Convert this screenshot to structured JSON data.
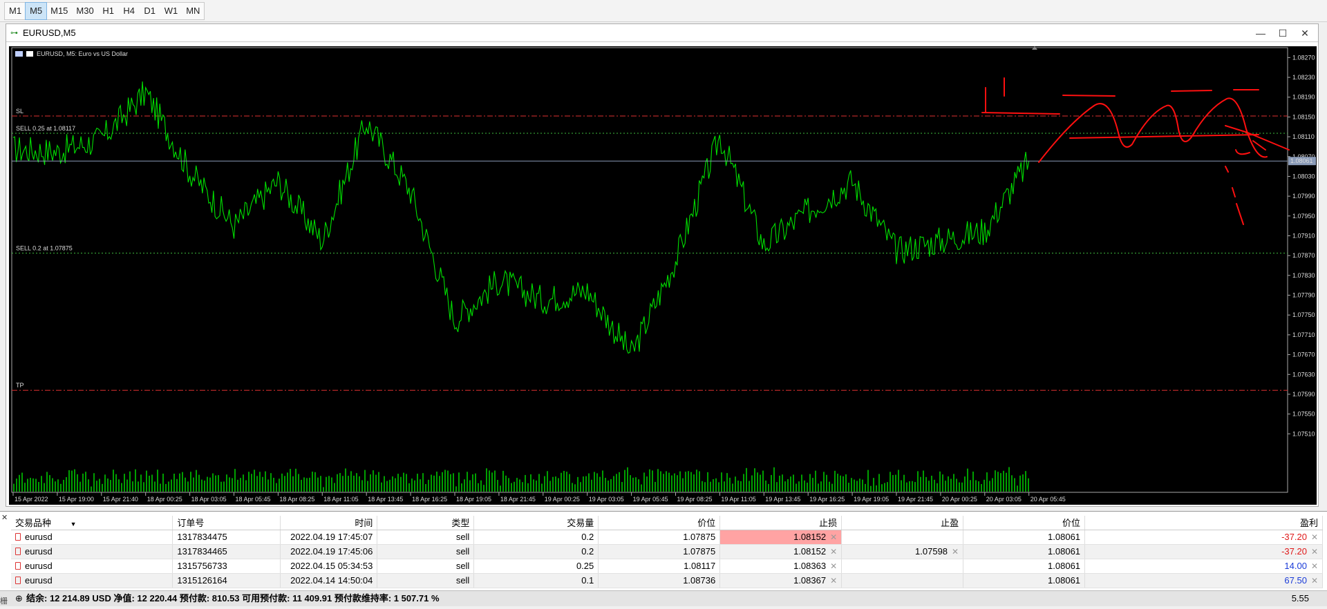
{
  "toolbar": {
    "timeframes": [
      {
        "label": "M1",
        "active": false
      },
      {
        "label": "M5",
        "active": true
      },
      {
        "label": "M15",
        "active": false
      },
      {
        "label": "M30",
        "active": false
      },
      {
        "label": "H1",
        "active": false
      },
      {
        "label": "H4",
        "active": false
      },
      {
        "label": "D1",
        "active": false
      },
      {
        "label": "W1",
        "active": false
      },
      {
        "label": "MN",
        "active": false
      }
    ]
  },
  "window": {
    "title": "EURUSD,M5",
    "controls": {
      "minimize": "—",
      "maximize": "☐",
      "close": "✕"
    }
  },
  "chart_data": {
    "type": "line",
    "symbol_caption": "EURUSD, M5:  Euro vs US Dollar",
    "line_color": "#00e000",
    "background": "#000000",
    "current_price": 1.08061,
    "ylim": [
      1.0747,
      1.0829
    ],
    "y_ticks": [
      "1.08270",
      "1.08230",
      "1.08190",
      "1.08150",
      "1.08110",
      "1.08070",
      "1.08030",
      "1.07990",
      "1.07950",
      "1.07910",
      "1.07870",
      "1.07830",
      "1.07790",
      "1.07750",
      "1.07710",
      "1.07670",
      "1.07630",
      "1.07590",
      "1.07550",
      "1.07510"
    ],
    "x_ticks": [
      "15 Apr 2022",
      "15 Apr 19:00",
      "15 Apr 21:40",
      "18 Apr 00:25",
      "18 Apr 03:05",
      "18 Apr 05:45",
      "18 Apr 08:25",
      "18 Apr 11:05",
      "18 Apr 13:45",
      "18 Apr 16:25",
      "18 Apr 19:05",
      "18 Apr 21:45",
      "19 Apr 00:25",
      "19 Apr 03:05",
      "19 Apr 05:45",
      "19 Apr 08:25",
      "19 Apr 11:05",
      "19 Apr 13:45",
      "19 Apr 16:25",
      "19 Apr 19:05",
      "19 Apr 21:45",
      "20 Apr 00:25",
      "20 Apr 03:05",
      "20 Apr 05:45"
    ],
    "levels": [
      {
        "label": "SL",
        "price": 1.08152,
        "style": "dashdot",
        "color": "#e03030"
      },
      {
        "label": "SELL 0.25 at 1.08117",
        "price": 1.08117,
        "style": "dotted",
        "color": "#40c040"
      },
      {
        "label": "SELL 0.2 at 1.07875",
        "price": 1.07875,
        "style": "dotted",
        "color": "#40c040"
      },
      {
        "label": "TP",
        "price": 1.07598,
        "style": "dashdot",
        "color": "#e03030"
      }
    ],
    "series": [
      {
        "x": "15 Apr 2022",
        "y": 1.08085
      },
      {
        "x": "15 Apr 19:00",
        "y": 1.0808
      },
      {
        "x": "15 Apr 21:40",
        "y": 1.08105
      },
      {
        "x": "18 Apr 00:25",
        "y": 1.082
      },
      {
        "x": "18 Apr 03:05",
        "y": 1.0804
      },
      {
        "x": "18 Apr 05:45",
        "y": 1.0793
      },
      {
        "x": "18 Apr 08:25",
        "y": 1.0802
      },
      {
        "x": "18 Apr 11:05",
        "y": 1.079
      },
      {
        "x": "18 Apr 13:45",
        "y": 1.0814
      },
      {
        "x": "18 Apr 16:25",
        "y": 1.08
      },
      {
        "x": "18 Apr 19:05",
        "y": 1.0774
      },
      {
        "x": "18 Apr 21:45",
        "y": 1.0782
      },
      {
        "x": "19 Apr 00:25",
        "y": 1.0778
      },
      {
        "x": "19 Apr 03:05",
        "y": 1.078
      },
      {
        "x": "19 Apr 05:45",
        "y": 1.0767
      },
      {
        "x": "19 Apr 08:25",
        "y": 1.0786
      },
      {
        "x": "19 Apr 11:05",
        "y": 1.0811
      },
      {
        "x": "19 Apr 13:45",
        "y": 1.0789
      },
      {
        "x": "19 Apr 16:25",
        "y": 1.0796
      },
      {
        "x": "19 Apr 19:05",
        "y": 1.0802
      },
      {
        "x": "19 Apr 21:45",
        "y": 1.0788
      },
      {
        "x": "20 Apr 00:25",
        "y": 1.079
      },
      {
        "x": "20 Apr 03:05",
        "y": 1.0792
      },
      {
        "x": "20 Apr 05:45",
        "y": 1.08061
      }
    ],
    "volume_color": "#00a000",
    "annotation_color": "#ff1010"
  },
  "positions": {
    "headers": [
      "交易品种",
      "订单号",
      "时间",
      "类型",
      "交易量",
      "价位",
      "止损",
      "止盈",
      "价位",
      "盈利"
    ],
    "rows": [
      {
        "symbol": "eurusd",
        "ticket": "1317834475",
        "time": "2022.04.19 17:45:07",
        "type": "sell",
        "volume": "0.2",
        "open_price": "1.07875",
        "sl": "1.08152",
        "tp": "",
        "price": "1.08061",
        "profit": "-37.20",
        "sl_hit": true
      },
      {
        "symbol": "eurusd",
        "ticket": "1317834465",
        "time": "2022.04.19 17:45:06",
        "type": "sell",
        "volume": "0.2",
        "open_price": "1.07875",
        "sl": "1.08152",
        "tp": "1.07598",
        "price": "1.08061",
        "profit": "-37.20",
        "sl_hit": true
      },
      {
        "symbol": "eurusd",
        "ticket": "1315756733",
        "time": "2022.04.15 05:34:53",
        "type": "sell",
        "volume": "0.25",
        "open_price": "1.08117",
        "sl": "1.08363",
        "tp": "",
        "price": "1.08061",
        "profit": "14.00",
        "sl_hit": false
      },
      {
        "symbol": "eurusd",
        "ticket": "1315126164",
        "time": "2022.04.14 14:50:04",
        "type": "sell",
        "volume": "0.1",
        "open_price": "1.08736",
        "sl": "1.08367",
        "tp": "",
        "price": "1.08061",
        "profit": "67.50",
        "sl_hit": false
      }
    ]
  },
  "status": {
    "side_char": "栅",
    "summary": "结余: 12 214.89 USD  净值: 12 220.44  预付款: 810.53  可用预付款: 11 409.91  预付款维持率: 1 507.71 %",
    "total": "5.55"
  }
}
